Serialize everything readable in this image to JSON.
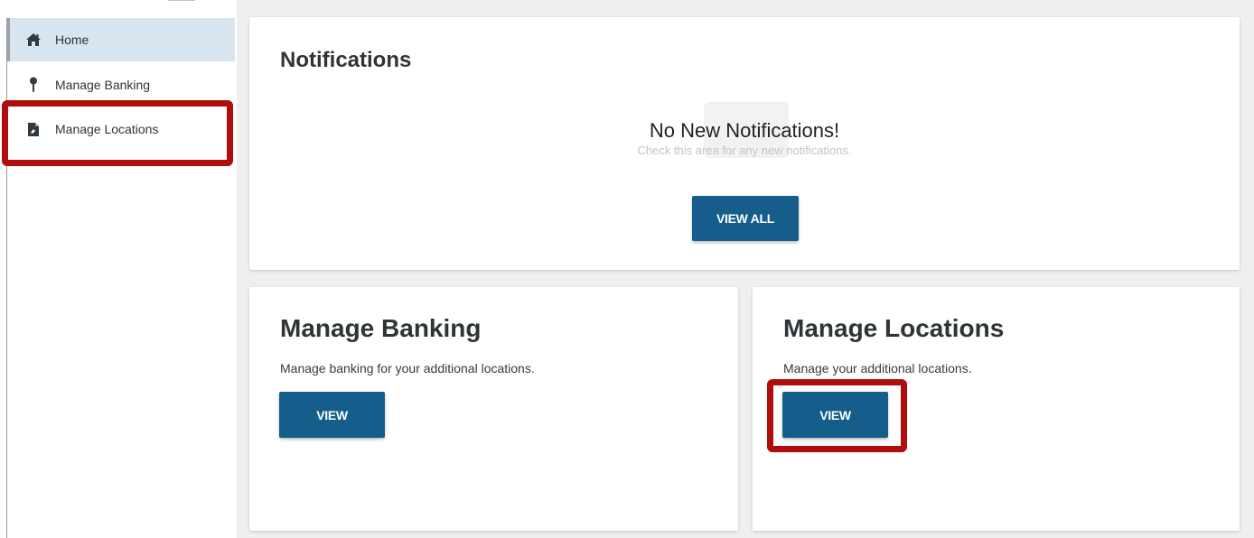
{
  "sidebar": {
    "items": [
      {
        "label": "Home",
        "icon": "home-icon",
        "active": true
      },
      {
        "label": "Manage Banking",
        "icon": "pin-icon",
        "active": false
      },
      {
        "label": "Manage Locations",
        "icon": "document-icon",
        "active": false
      }
    ]
  },
  "notifications": {
    "title": "Notifications",
    "empty_title": "No New Notifications!",
    "empty_subtitle": "Check this area for any new notifications.",
    "view_all_label": "VIEW ALL"
  },
  "manage_banking": {
    "title": "Manage Banking",
    "description": "Manage banking for your additional locations.",
    "button_label": "VIEW"
  },
  "manage_locations": {
    "title": "Manage Locations",
    "description": "Manage your additional locations.",
    "button_label": "VIEW"
  },
  "colors": {
    "primary_button": "#155e8c",
    "highlight": "#b00d0d",
    "active_nav": "#d8e4ee",
    "background": "#efefef"
  }
}
